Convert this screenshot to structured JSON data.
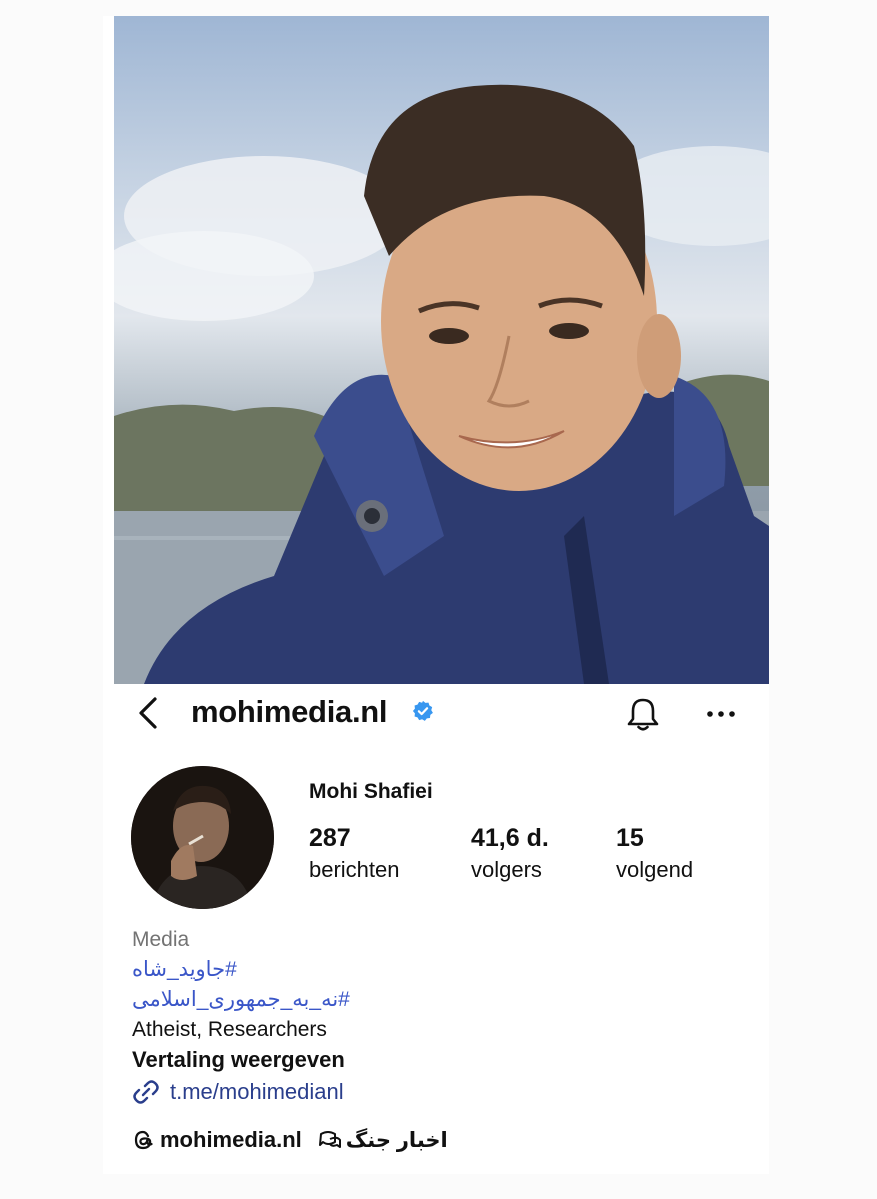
{
  "header": {
    "username": "mohimedia.nl",
    "icons": {
      "back": "chevron-left-icon",
      "verified": "verified-badge-icon",
      "notifications": "bell-icon",
      "more": "more-horizontal-icon"
    },
    "accent_color": "#3897f0"
  },
  "profile": {
    "full_name": "Mohi Shafiei",
    "stats": [
      {
        "value": "287",
        "label": "berichten"
      },
      {
        "value": "41,6 d.",
        "label": "volgers"
      },
      {
        "value": "15",
        "label": "volgend"
      }
    ]
  },
  "bio": {
    "category": "Media",
    "hashtags": [
      "#جاوید_شاه",
      "#نه_به_جمهوری_اسلامی"
    ],
    "description": "Atheist, Researchers",
    "translate_label": "Vertaling weergeven",
    "link": "t.me/mohimedianl",
    "link_icon": "link-icon",
    "hashtag_color": "#3a56c8"
  },
  "footer": {
    "threads_handle": "mohimedia.nl",
    "threads_icon": "threads-icon",
    "channel_name": "اخبار جنگ",
    "channel_icon": "broadcast-channel-icon"
  }
}
